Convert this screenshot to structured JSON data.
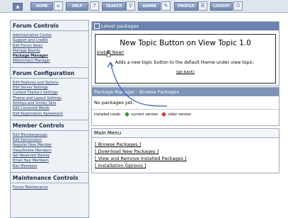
{
  "nav": {
    "home": "HOME",
    "help": "HELP",
    "search": "SEARCH",
    "admin": "ADMIN",
    "profile": "PROFILE",
    "logout": "LOGOUT"
  },
  "sidebar": {
    "forum_controls": {
      "title": "Forum Controls",
      "items": [
        "Administration Center",
        "Support and Credits",
        "Edit Forum News",
        "Manage Boards",
        "Package Manager",
        "Attachment Manager"
      ]
    },
    "forum_configuration": {
      "title": "Forum Configuration",
      "items": [
        "Edit Features and Options",
        "Edit Server Settings",
        "Current Theme's Settings",
        "Theme and Layout Settings",
        "Smileys and Smiley Sets",
        "Edit Censored Words",
        "Edit Registration Agreement"
      ]
    },
    "member_controls": {
      "title": "Member Controls",
      "items": [
        "Edit Membergroups",
        "Edit Permissions",
        "Register New Member",
        "View/Delete Members",
        "Set Reserved Names",
        "Email Your Members",
        "Ban Members"
      ]
    },
    "maintenance_controls": {
      "title": "Maintenance Controls",
      "items": [
        "Forum Maintenance"
      ]
    }
  },
  "latest": {
    "header": "Latest packages",
    "title": "New Topic Button on View Topic 1.0",
    "install": "Install Now!",
    "description": "Adds a new topic button to the default theme under view topic.",
    "go_back": "(go back)"
  },
  "browse": {
    "header": "Package Manager - Browse Packages",
    "no_packages": "No packages yet.",
    "installed_mods": "Installed mods:",
    "current_version": "current version",
    "older_version": "older version",
    "colors": {
      "current": "#3c9a3c",
      "older": "#d93a3a"
    }
  },
  "main_menu": {
    "title": "Main Menu",
    "items": [
      "[ Browse Packages ]",
      "[ Download New Packages ]",
      "[ View and Remove Installed Packages ]",
      "[ Installation Options ]"
    ]
  }
}
